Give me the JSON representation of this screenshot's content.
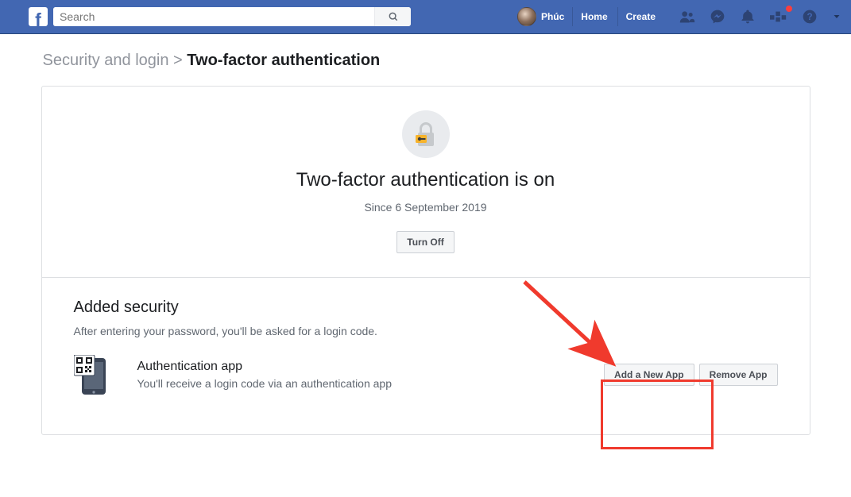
{
  "topbar": {
    "search_placeholder": "Search",
    "profile_name": "Phúc",
    "nav": {
      "home": "Home",
      "create": "Create"
    }
  },
  "breadcrumb": {
    "parent": "Security and login",
    "sep": ">",
    "current": "Two-factor authentication"
  },
  "tfa": {
    "title": "Two-factor authentication is on",
    "since": "Since 6 September 2019",
    "turn_off": "Turn Off"
  },
  "added_security": {
    "title": "Added security",
    "desc": "After entering your password, you'll be asked for a login code.",
    "auth_app": {
      "title": "Authentication app",
      "desc": "You'll receive a login code via an authentication app",
      "add_label": "Add a New App",
      "remove_label": "Remove App"
    }
  }
}
